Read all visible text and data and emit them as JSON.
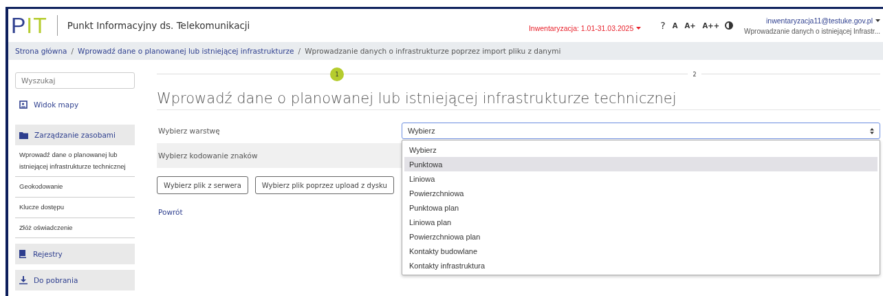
{
  "header": {
    "logo": {
      "part_1": "P",
      "part_2": "I",
      "part_3": "T"
    },
    "app_title": "Punkt Informacyjny ds. Telekomunikacji",
    "period": "Inwentaryzacja: 1.01-31.03.2025",
    "tools": [
      {
        "kind": "help",
        "label": "?"
      },
      {
        "kind": "font",
        "label": "A"
      },
      {
        "kind": "font",
        "label": "A+"
      },
      {
        "kind": "font",
        "label": "A++"
      },
      {
        "kind": "contrast"
      }
    ],
    "user_email": "inwentaryzacja11@testuke.gov.pl",
    "user_context": "Wprowadzanie danych o istniejącej Infrastr..."
  },
  "breadcrumb": [
    {
      "label": "Strona główna",
      "link": true
    },
    {
      "separator": "/",
      "label": "Wprowadź dane o planowanej lub istniejącej infrastrukturze",
      "link": true
    },
    {
      "separator": "/",
      "label": "Wprowadzanie danych o infrastrukturze poprzez import pliku z danymi",
      "link": false
    }
  ],
  "sidebar": {
    "search": {
      "placeholder": "Wyszukaj"
    },
    "items": [
      {
        "label": "Widok mapy",
        "kind": "link"
      },
      {
        "label": "Zarządzanie zasobami",
        "kind": "section",
        "children": [
          {
            "label": "Wprowadź dane o planowanej lub istniejącej infrastrukturze technicznej"
          },
          {
            "label": "Geokodowanie"
          },
          {
            "label": "Klucze dostępu"
          },
          {
            "label": "Złóż oświadczenie"
          }
        ]
      },
      {
        "label": "Rejestry",
        "kind": "section"
      },
      {
        "label": "Do pobrania",
        "kind": "section"
      }
    ]
  },
  "steps": [
    {
      "label": "1",
      "selected": true
    },
    {
      "label": "2",
      "selected": false
    }
  ],
  "title": "Wprowadź dane o planowanej lub istniejącej infrastrukturze technicznej",
  "form": {
    "layer_label": "Wybierz warstwę",
    "layer_value": "Wybierz",
    "encoding_label": "Wybierz kodowanie znaków",
    "buttons": [
      "Wybierz plik z serwera",
      "Wybierz plik poprzez upload z dysku"
    ],
    "back_link": "Powrót"
  },
  "dropdown": {
    "options": [
      {
        "label": "Wybierz",
        "selected": false
      },
      {
        "label": "Punktowa",
        "selected": true
      },
      {
        "label": "Liniowa",
        "selected": false
      },
      {
        "label": "Powierzchniowa",
        "selected": false
      },
      {
        "label": "Punktowa plan",
        "selected": false
      },
      {
        "label": "Liniowa plan",
        "selected": false
      },
      {
        "label": "Powierzchniowa plan",
        "selected": false
      },
      {
        "label": "Kontakty budowlane",
        "selected": false
      },
      {
        "label": "Kontakty infrastruktura",
        "selected": false
      }
    ]
  }
}
